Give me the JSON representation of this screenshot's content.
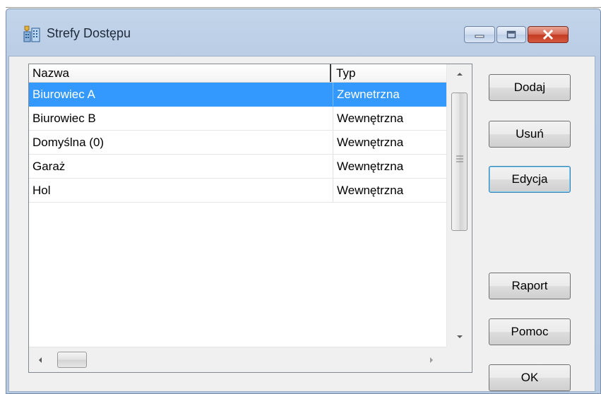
{
  "window": {
    "title": "Strefy Dostępu",
    "icon": "access-zones-app-icon"
  },
  "title_buttons": {
    "minimize": "minimize-icon",
    "maximize": "maximize-icon",
    "close": "close-icon"
  },
  "list": {
    "columns": [
      "Nazwa",
      "Typ"
    ],
    "rows": [
      {
        "name": "Biurowiec A",
        "type": "Zewnetrzna",
        "selected": true
      },
      {
        "name": "Biurowiec B",
        "type": "Wewnętrzna",
        "selected": false
      },
      {
        "name": "Domyślna (0)",
        "type": "Wewnętrzna",
        "selected": false
      },
      {
        "name": "Garaż",
        "type": "Wewnętrzna",
        "selected": false
      },
      {
        "name": "Hol",
        "type": "Wewnętrzna",
        "selected": false
      }
    ]
  },
  "buttons": {
    "add": "Dodaj",
    "remove": "Usuń",
    "edit": "Edycja",
    "report": "Raport",
    "help": "Pomoc",
    "ok": "OK"
  },
  "colors": {
    "selection": "#3399ff",
    "close_button": "#c43b22",
    "titlebar": "#bdd0e7"
  }
}
